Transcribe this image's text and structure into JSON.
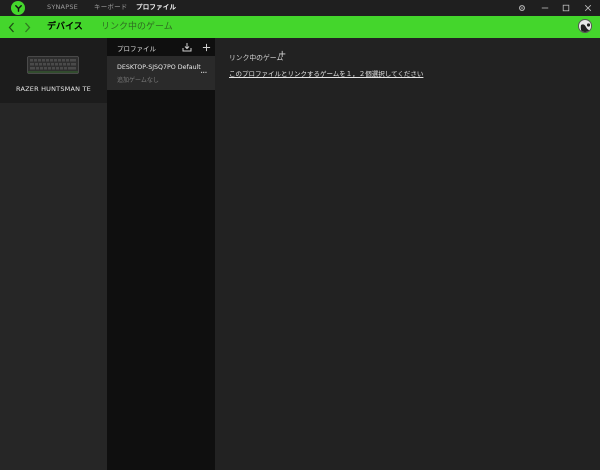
{
  "titlebar": {
    "tabs": [
      {
        "label": "SYNAPSE",
        "active": false
      },
      {
        "label": "キーボード",
        "active": false
      },
      {
        "label": "プロファイル",
        "active": true
      }
    ],
    "controls": {
      "settings": "⚙",
      "minimize": "—",
      "maximize": "☐",
      "close": "✕"
    }
  },
  "header": {
    "tabs": [
      {
        "label": "デバイス",
        "active": true
      },
      {
        "label": "リンク中のゲーム",
        "active": false
      }
    ]
  },
  "device": {
    "name": "RAZER HUNTSMAN TE"
  },
  "profiles": {
    "title": "プロファイル",
    "items": [
      {
        "name": "DESKTOP-SJSQ7PO Default",
        "subtitle": "追加ゲームなし",
        "menu": "..."
      }
    ]
  },
  "linked_games": {
    "title": "リンク中のゲーム",
    "add_symbol": "+",
    "link_text": "このプロファイルとリンクするゲームを１，２個選択してください"
  },
  "colors": {
    "accent": "#44d62c",
    "background": "#1a1a1a",
    "panel_dark": "#0f0f0f",
    "panel_main": "#222222"
  }
}
